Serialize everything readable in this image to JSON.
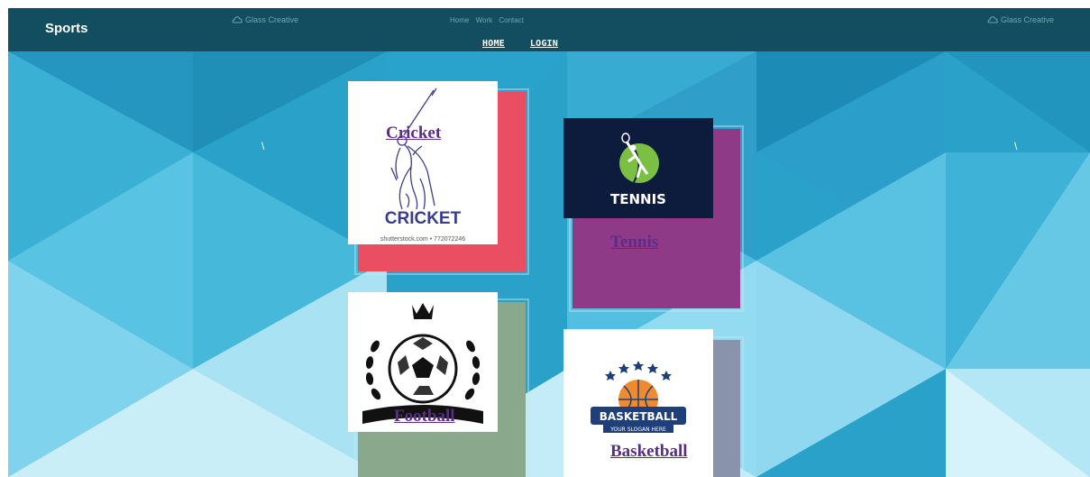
{
  "header": {
    "brand": "Sports",
    "glass_left": "Glass Creative",
    "glass_right": "Glass Creative",
    "minor_nav": [
      "Home",
      "Work",
      "Contact"
    ],
    "nav": {
      "home": "HOME",
      "login": "LOGIN"
    }
  },
  "decor": {
    "tick_left": "\\",
    "tick_right": "\\"
  },
  "cards": {
    "cricket": {
      "link": "Cricket",
      "logo_text": "CRICKET",
      "credit": "shutterstock.com • 772072246",
      "color": "#ea4e62"
    },
    "tennis": {
      "link": "Tennis",
      "logo_text": "TENNIS",
      "color": "#8e3a86"
    },
    "football": {
      "link": "Football",
      "color": "#8aa98c"
    },
    "basketball": {
      "link": "Basketball",
      "logo_text": "BASKETBALL",
      "slogan": "YOUR SLOGAN HERE",
      "color": "#8993ab"
    }
  },
  "colors": {
    "header_bg": "#124e60",
    "link": "#5b2c88"
  }
}
